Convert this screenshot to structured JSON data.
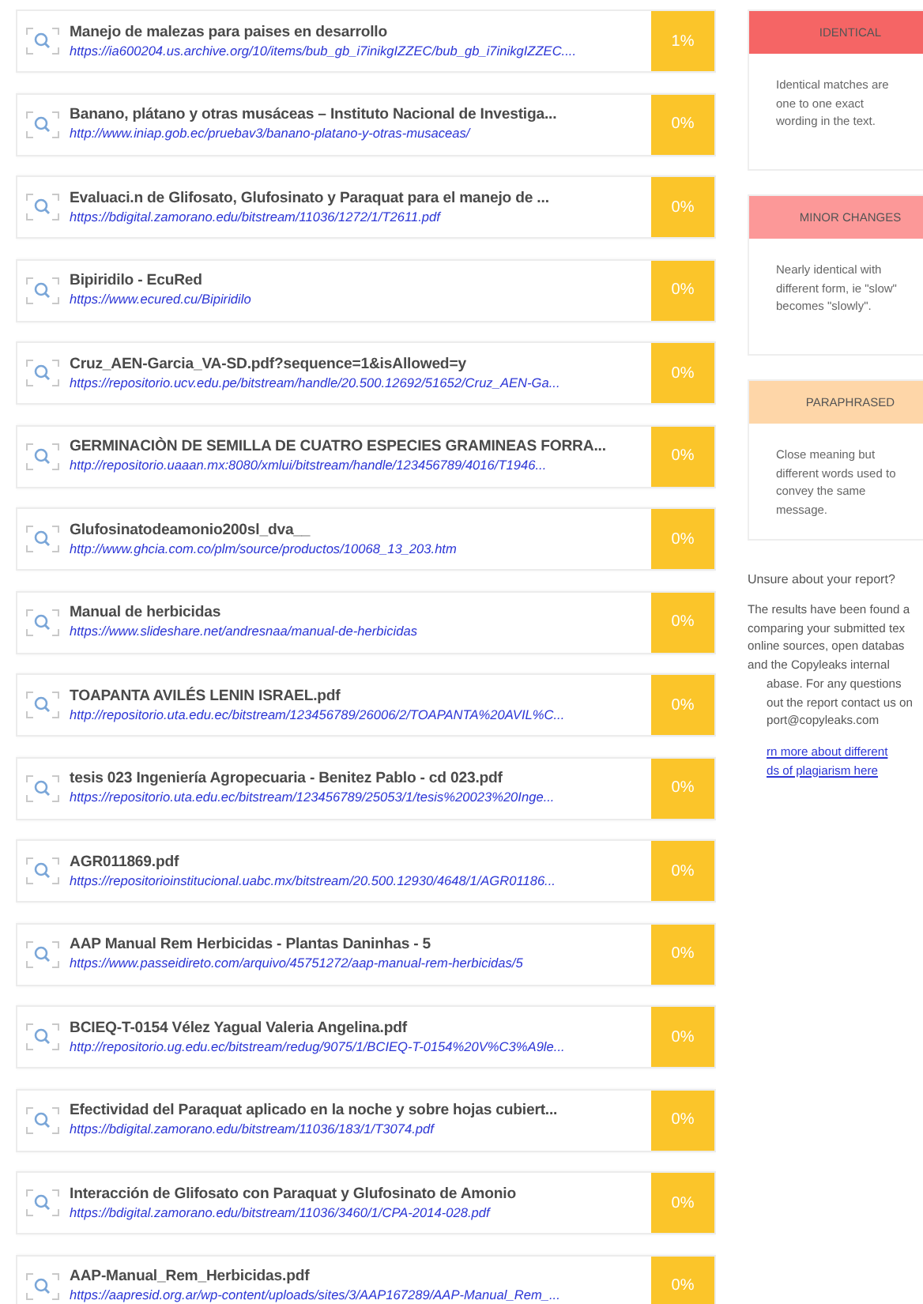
{
  "sources": [
    {
      "title": "Manejo de malezas para paises en desarrollo",
      "url": "https://ia600204.us.archive.org/10/items/bub_gb_i7inikgIZZEC/bub_gb_i7inikgIZZEC....",
      "percent": "1%"
    },
    {
      "title": "Banano, plátano y otras musáceas – Instituto Nacional de Investiga...",
      "url": "http://www.iniap.gob.ec/pruebav3/banano-platano-y-otras-musaceas/",
      "percent": "0%"
    },
    {
      "title": "Evaluaci.n de Glifosato, Glufosinato y Paraquat para el manejo de ...",
      "url": "https://bdigital.zamorano.edu/bitstream/11036/1272/1/T2611.pdf",
      "percent": "0%"
    },
    {
      "title": "Bipiridilo - EcuRed",
      "url": "https://www.ecured.cu/Bipiridilo",
      "percent": "0%"
    },
    {
      "title": "Cruz_AEN-Garcia_VA-SD.pdf?sequence=1&isAllowed=y",
      "url": "https://repositorio.ucv.edu.pe/bitstream/handle/20.500.12692/51652/Cruz_AEN-Ga...",
      "percent": "0%"
    },
    {
      "title": "GERMINACIÒN DE SEMILLA DE CUATRO ESPECIES GRAMINEAS FORRA...",
      "url": "http://repositorio.uaaan.mx:8080/xmlui/bitstream/handle/123456789/4016/T1946...",
      "percent": "0%"
    },
    {
      "title": "Glufosinatodeamonio200sl_dva__",
      "url": "http://www.ghcia.com.co/plm/source/productos/10068_13_203.htm",
      "percent": "0%"
    },
    {
      "title": "Manual de herbicidas",
      "url": "https://www.slideshare.net/andresnaa/manual-de-herbicidas",
      "percent": "0%"
    },
    {
      "title": "TOAPANTA AVILÉS LENIN ISRAEL.pdf",
      "url": "http://repositorio.uta.edu.ec/bitstream/123456789/26006/2/TOAPANTA%20AVIL%C...",
      "percent": "0%"
    },
    {
      "title": "tesis 023 Ingeniería Agropecuaria - Benitez Pablo - cd 023.pdf",
      "url": "https://repositorio.uta.edu.ec/bitstream/123456789/25053/1/tesis%20023%20Inge...",
      "percent": "0%"
    },
    {
      "title": "AGR011869.pdf",
      "url": "https://repositorioinstitucional.uabc.mx/bitstream/20.500.12930/4648/1/AGR01186...",
      "percent": "0%"
    },
    {
      "title": "AAP Manual Rem Herbicidas - Plantas Daninhas - 5",
      "url": "https://www.passeidireto.com/arquivo/45751272/aap-manual-rem-herbicidas/5",
      "percent": "0%"
    },
    {
      "title": "BCIEQ-T-0154 Vélez Yagual Valeria Angelina.pdf",
      "url": "http://repositorio.ug.edu.ec/bitstream/redug/9075/1/BCIEQ-T-0154%20V%C3%A9le...",
      "percent": "0%"
    },
    {
      "title": "Efectividad del Paraquat aplicado en la noche y sobre hojas cubiert...",
      "url": "https://bdigital.zamorano.edu/bitstream/11036/183/1/T3074.pdf",
      "percent": "0%"
    },
    {
      "title": "Interacción de Glifosato con Paraquat y Glufosinato de Amonio",
      "url": "https://bdigital.zamorano.edu/bitstream/11036/3460/1/CPA-2014-028.pdf",
      "percent": "0%"
    },
    {
      "title": "AAP-Manual_Rem_Herbicidas.pdf",
      "url": "https://aapresid.org.ar/wp-content/uploads/sites/3/AAP167289/AAP-Manual_Rem_...",
      "percent": "0%"
    }
  ],
  "legend": [
    {
      "label": "IDENTICAL",
      "description": "Identical matches are one to one exact wording in the text.",
      "color": "#f56565"
    },
    {
      "label": "MINOR CHANGES",
      "description": "Nearly identical with different form, ie \"slow\" becomes \"slowly\".",
      "color": "#fc9898"
    },
    {
      "label": "PARAPHRASED",
      "description": "Close meaning but different words used to convey the same message.",
      "color": "#fed6a8"
    }
  ],
  "help": {
    "heading": "Unsure about your report?",
    "lines": [
      {
        "text": "The results have been found a",
        "indented": false
      },
      {
        "text": "comparing your submitted tex",
        "indented": false
      },
      {
        "text": "online sources, open databas",
        "indented": false
      },
      {
        "text": "and the Copyleaks internal",
        "indented": false
      },
      {
        "text": "abase. For any questions",
        "indented": true
      },
      {
        "text": "out the report contact us on",
        "indented": true
      },
      {
        "text": "port@copyleaks.com",
        "indented": true
      }
    ],
    "link_lines": [
      "rn more about different",
      "ds of plagiarism here"
    ]
  }
}
